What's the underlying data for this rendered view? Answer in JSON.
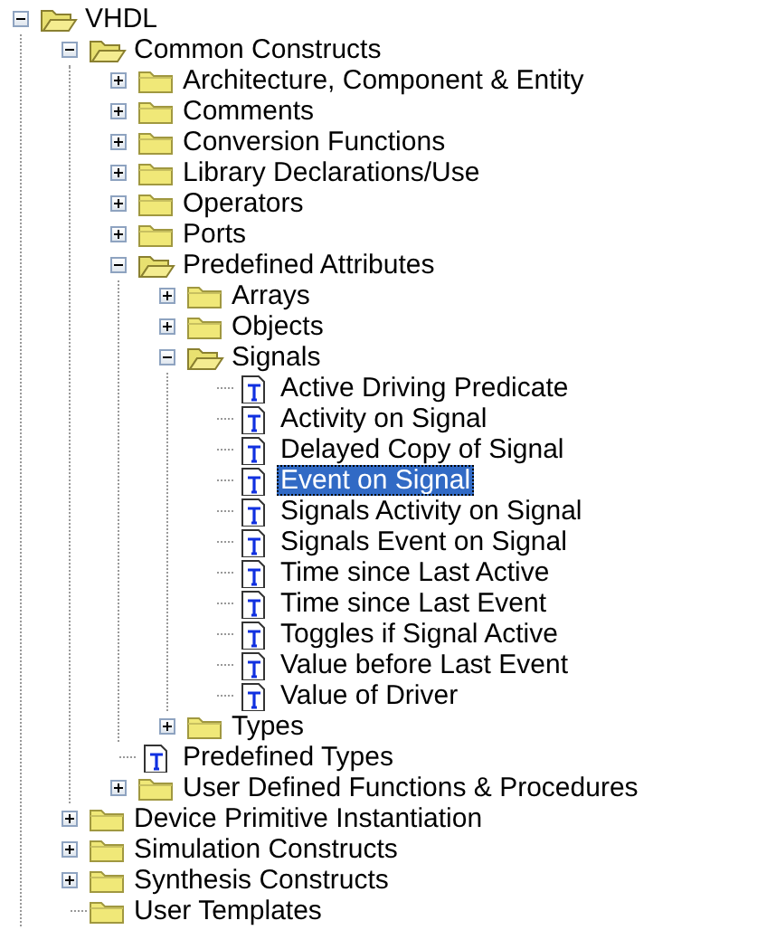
{
  "tree": [
    {
      "label": "VHDL",
      "kind": "folder",
      "expanded": true,
      "selected": false,
      "children": [
        {
          "label": "Common Constructs",
          "kind": "folder",
          "expanded": true,
          "selected": false,
          "children": [
            {
              "label": "Architecture, Component & Entity",
              "kind": "folder",
              "expanded": false,
              "selected": false
            },
            {
              "label": "Comments",
              "kind": "folder",
              "expanded": false,
              "selected": false
            },
            {
              "label": "Conversion Functions",
              "kind": "folder",
              "expanded": false,
              "selected": false
            },
            {
              "label": "Library Declarations/Use",
              "kind": "folder",
              "expanded": false,
              "selected": false
            },
            {
              "label": "Operators",
              "kind": "folder",
              "expanded": false,
              "selected": false
            },
            {
              "label": "Ports",
              "kind": "folder",
              "expanded": false,
              "selected": false
            },
            {
              "label": "Predefined Attributes",
              "kind": "folder",
              "expanded": true,
              "selected": false,
              "children": [
                {
                  "label": "Arrays",
                  "kind": "folder",
                  "expanded": false,
                  "selected": false
                },
                {
                  "label": "Objects",
                  "kind": "folder",
                  "expanded": false,
                  "selected": false
                },
                {
                  "label": "Signals",
                  "kind": "folder",
                  "expanded": true,
                  "selected": false,
                  "children": [
                    {
                      "label": "Active Driving Predicate",
                      "kind": "template",
                      "selected": false
                    },
                    {
                      "label": "Activity on Signal",
                      "kind": "template",
                      "selected": false
                    },
                    {
                      "label": "Delayed Copy of Signal",
                      "kind": "template",
                      "selected": false
                    },
                    {
                      "label": "Event on Signal",
                      "kind": "template",
                      "selected": true
                    },
                    {
                      "label": "Signals Activity on Signal",
                      "kind": "template",
                      "selected": false
                    },
                    {
                      "label": "Signals Event on Signal",
                      "kind": "template",
                      "selected": false
                    },
                    {
                      "label": "Time since Last Active",
                      "kind": "template",
                      "selected": false
                    },
                    {
                      "label": "Time since Last Event",
                      "kind": "template",
                      "selected": false
                    },
                    {
                      "label": "Toggles if Signal Active",
                      "kind": "template",
                      "selected": false
                    },
                    {
                      "label": "Value before Last Event",
                      "kind": "template",
                      "selected": false
                    },
                    {
                      "label": "Value of Driver",
                      "kind": "template",
                      "selected": false
                    }
                  ]
                },
                {
                  "label": "Types",
                  "kind": "folder",
                  "expanded": false,
                  "selected": false
                }
              ]
            },
            {
              "label": "Predefined Types",
              "kind": "template",
              "selected": false
            },
            {
              "label": "User Defined Functions & Procedures",
              "kind": "folder",
              "expanded": false,
              "selected": false
            }
          ]
        },
        {
          "label": "Device Primitive Instantiation",
          "kind": "folder",
          "expanded": false,
          "selected": false
        },
        {
          "label": "Simulation Constructs",
          "kind": "folder",
          "expanded": false,
          "selected": false
        },
        {
          "label": "Synthesis Constructs",
          "kind": "folder",
          "expanded": false,
          "selected": false
        },
        {
          "label": "User Templates",
          "kind": "folder",
          "selected": false
        }
      ]
    }
  ]
}
